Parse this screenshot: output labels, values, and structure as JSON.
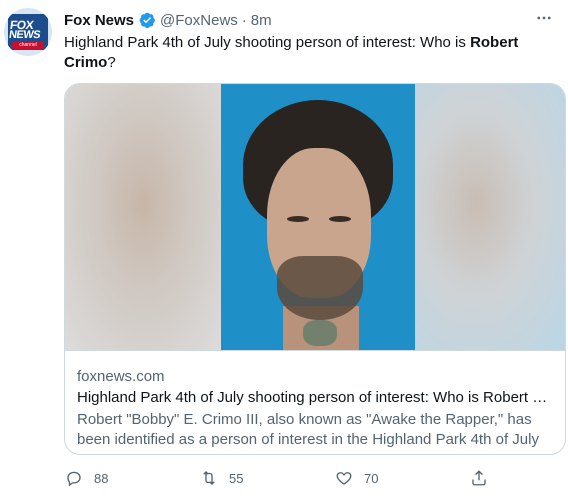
{
  "tweet": {
    "author_name": "Fox News",
    "author_handle": "@FoxNews",
    "separator": "·",
    "time": "8m",
    "text_prefix": "Highland Park 4th of July shooting person of interest: Who is ",
    "text_bold": "Robert Crimo",
    "text_suffix": "?",
    "avatar_logo_line1": "FOX",
    "avatar_logo_line2": "NEWS",
    "avatar_logo_line3": "channel"
  },
  "card": {
    "domain": "foxnews.com",
    "title": "Highland Park 4th of July shooting person of interest: Who is Robert C...",
    "description": "Robert \"Bobby\" E. Crimo III, also known as \"Awake the Rapper,\" has been identified as a person of interest in the Highland Park 4th of July ..."
  },
  "actions": {
    "reply_count": "88",
    "retweet_count": "55",
    "like_count": "70"
  },
  "icons": {
    "verified": "verified-badge-icon",
    "more": "more-horizontal-icon",
    "reply": "reply-icon",
    "retweet": "retweet-icon",
    "like": "heart-icon",
    "share": "share-icon"
  },
  "colors": {
    "verified_blue": "#1d9bf0",
    "secondary_text": "#536471",
    "primary_text": "#0f1419",
    "border": "#cfd9de"
  }
}
